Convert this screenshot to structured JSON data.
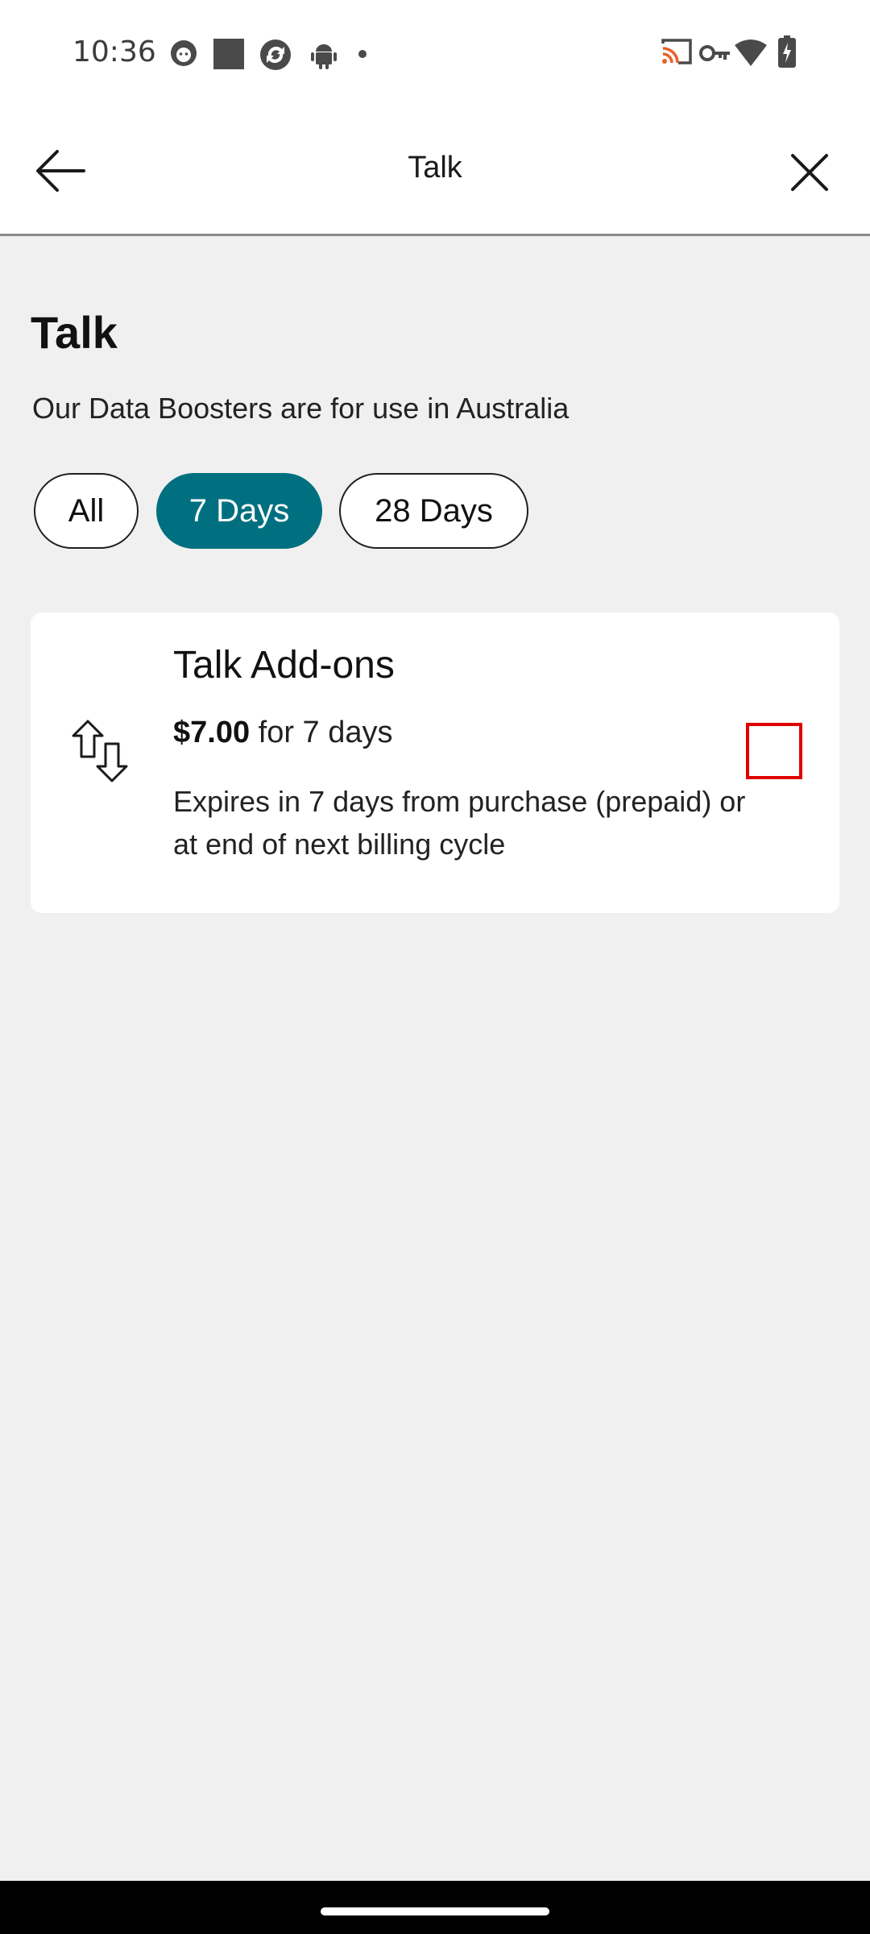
{
  "status_bar": {
    "time": "10:36",
    "left_icons": [
      "cat-notification-icon",
      "square-notification-icon",
      "sync-notification-icon",
      "android-notification-icon",
      "dot-notification-icon"
    ],
    "right_icons": [
      "cast-icon",
      "vpn-key-icon",
      "wifi-icon",
      "battery-charging-icon"
    ],
    "cast_color": "#e8602c"
  },
  "app_bar": {
    "title": "Talk",
    "back_icon": "arrow-left-icon",
    "close_icon": "close-icon"
  },
  "page": {
    "title": "Talk",
    "subtitle": "Our Data Boosters are for use in Australia"
  },
  "filters": {
    "selected": "7 Days",
    "options": [
      {
        "label": "All",
        "active": false
      },
      {
        "label": "7 Days",
        "active": true
      },
      {
        "label": "28 Days",
        "active": false
      }
    ],
    "accent_color": "#007080"
  },
  "card": {
    "icon": "up-down-arrows-icon",
    "title": "Talk Add-ons",
    "price": "$7.00",
    "period": "for 7 days",
    "description": "Expires in 7 days from purchase (prepaid) or at end of next billing cycle",
    "checked": false,
    "checkbox_color": "#e00000"
  }
}
